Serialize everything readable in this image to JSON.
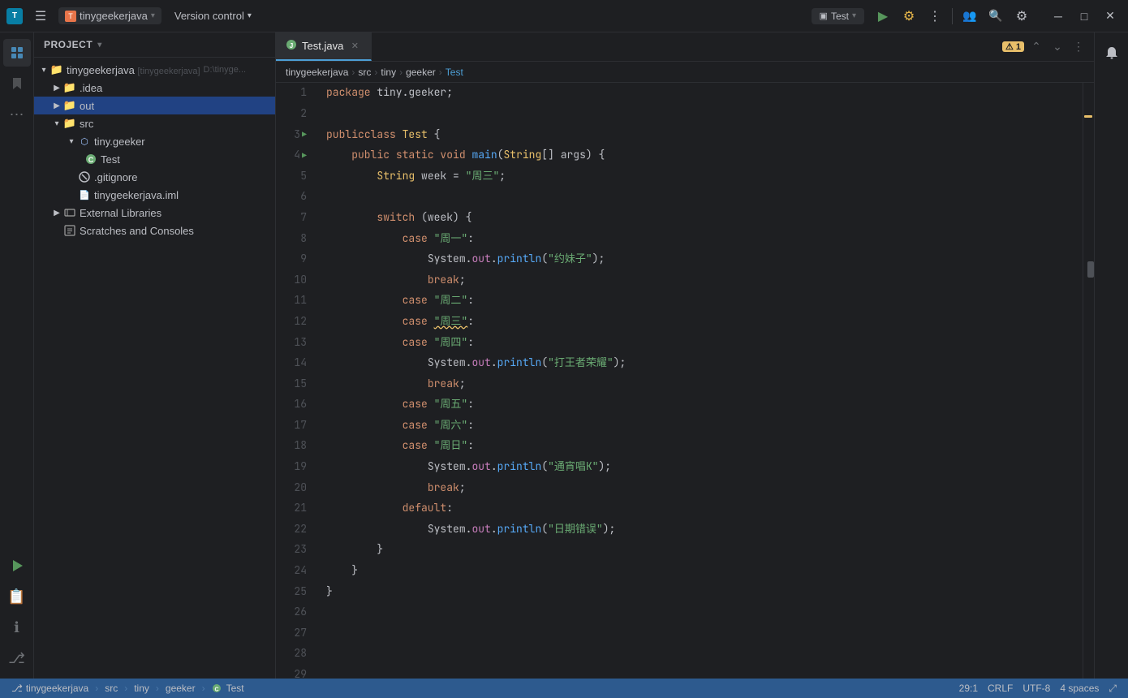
{
  "titlebar": {
    "logo": "T",
    "project_name": "tinygeekerjava",
    "project_chevron": "▾",
    "menu_icon": "☰",
    "version_control": "Version control",
    "version_chevron": "▾",
    "run_config": "Test",
    "run_config_chevron": "▾",
    "actions": {
      "run": "▶",
      "debug": "⚙",
      "more": "⋮",
      "collab": "👤",
      "search": "🔍",
      "settings": "⚙",
      "minimize": "—",
      "maximize": "□",
      "close": "✕"
    }
  },
  "sidebar": {
    "header": "Project",
    "header_chevron": "▾",
    "tree": [
      {
        "id": "root",
        "label": "tinygeekerjava [tinygeekerjava]",
        "suffix": " D:\\tinyge...",
        "indent": 0,
        "arrow": "▾",
        "icon": "📁",
        "icon_color": "#e8754a",
        "selected": false
      },
      {
        "id": "idea",
        "label": ".idea",
        "indent": 1,
        "arrow": "▶",
        "icon": "📁",
        "icon_color": "#a0a0a0",
        "selected": false
      },
      {
        "id": "out",
        "label": "out",
        "indent": 1,
        "arrow": "▶",
        "icon": "📁",
        "icon_color": "#e8754a",
        "selected": true
      },
      {
        "id": "src",
        "label": "src",
        "indent": 1,
        "arrow": "▾",
        "icon": "📁",
        "icon_color": "#a0a0a0",
        "selected": false
      },
      {
        "id": "tiny.geeker",
        "label": "tiny.geeker",
        "indent": 2,
        "arrow": "▾",
        "icon": "📦",
        "icon_color": "#a0c4ff",
        "selected": false
      },
      {
        "id": "Test",
        "label": "Test",
        "indent": 3,
        "arrow": "",
        "icon": "☕",
        "icon_color": "#6aab73",
        "selected": false
      },
      {
        "id": ".gitignore",
        "label": ".gitignore",
        "indent": 2,
        "arrow": "",
        "icon": "🚫",
        "icon_color": "#bcbec4",
        "selected": false
      },
      {
        "id": "tinygeekerjava.iml",
        "label": "tinygeekerjava.iml",
        "indent": 2,
        "arrow": "",
        "icon": "📄",
        "icon_color": "#bcbec4",
        "selected": false
      },
      {
        "id": "external",
        "label": "External Libraries",
        "indent": 1,
        "arrow": "▶",
        "icon": "📚",
        "icon_color": "#a0a0a0",
        "selected": false
      },
      {
        "id": "scratches",
        "label": "Scratches and Consoles",
        "indent": 1,
        "arrow": "",
        "icon": "⊞",
        "icon_color": "#a0a0a0",
        "selected": false
      }
    ]
  },
  "editor": {
    "tab_name": "Test.java",
    "tab_icon": "☕",
    "warning_count": "1",
    "breadcrumb": [
      "tinygeekerjava",
      "src",
      "tiny",
      "geeker",
      "Test"
    ],
    "lines": [
      {
        "num": 1,
        "has_run": false,
        "content": "package tiny.geeker;"
      },
      {
        "num": 2,
        "has_run": false,
        "content": ""
      },
      {
        "num": 3,
        "has_run": true,
        "content": "public class Test {"
      },
      {
        "num": 4,
        "has_run": true,
        "content": "    public static void main(String[] args) {"
      },
      {
        "num": 5,
        "has_run": false,
        "content": "        String week = \"周三\";"
      },
      {
        "num": 6,
        "has_run": false,
        "content": ""
      },
      {
        "num": 7,
        "has_run": false,
        "content": "        switch (week) {"
      },
      {
        "num": 8,
        "has_run": false,
        "content": "            case \"周一\":"
      },
      {
        "num": 9,
        "has_run": false,
        "content": "                System.out.println(\"约妹子\");"
      },
      {
        "num": 10,
        "has_run": false,
        "content": "                break;"
      },
      {
        "num": 11,
        "has_run": false,
        "content": "            case \"周二\":"
      },
      {
        "num": 12,
        "has_run": false,
        "content": "            case \"周三\":"
      },
      {
        "num": 13,
        "has_run": false,
        "content": "            case \"周四\":"
      },
      {
        "num": 14,
        "has_run": false,
        "content": "                System.out.println(\"打王者荣耀\");"
      },
      {
        "num": 15,
        "has_run": false,
        "content": "                break;"
      },
      {
        "num": 16,
        "has_run": false,
        "content": "            case \"周五\":"
      },
      {
        "num": 17,
        "has_run": false,
        "content": "            case \"周六\":"
      },
      {
        "num": 18,
        "has_run": false,
        "content": "            case \"周日\":"
      },
      {
        "num": 19,
        "has_run": false,
        "content": "                System.out.println(\"通宵唱K\");"
      },
      {
        "num": 20,
        "has_run": false,
        "content": "                break;"
      },
      {
        "num": 21,
        "has_run": false,
        "content": "            default:"
      },
      {
        "num": 22,
        "has_run": false,
        "content": "                System.out.println(\"日期错误\");"
      },
      {
        "num": 23,
        "has_run": false,
        "content": "        }"
      },
      {
        "num": 24,
        "has_run": false,
        "content": "    }"
      },
      {
        "num": 25,
        "has_run": false,
        "content": "}"
      },
      {
        "num": 26,
        "has_run": false,
        "content": ""
      },
      {
        "num": 27,
        "has_run": false,
        "content": ""
      },
      {
        "num": 28,
        "has_run": false,
        "content": ""
      },
      {
        "num": 29,
        "has_run": false,
        "content": ""
      }
    ]
  },
  "status_bar": {
    "project": "tinygeekerjava",
    "src": "src",
    "tiny": "tiny",
    "geeker": "geeker",
    "test": "Test",
    "position": "29:1",
    "line_ending": "CRLF",
    "encoding": "UTF-8",
    "indent": "4 spaces"
  },
  "rail_icons": {
    "left": [
      "📁",
      "⬡",
      "⋯"
    ],
    "bottom_left": [
      "▶",
      "📋",
      "ℹ",
      "⎇"
    ],
    "right": [
      "📌"
    ]
  }
}
